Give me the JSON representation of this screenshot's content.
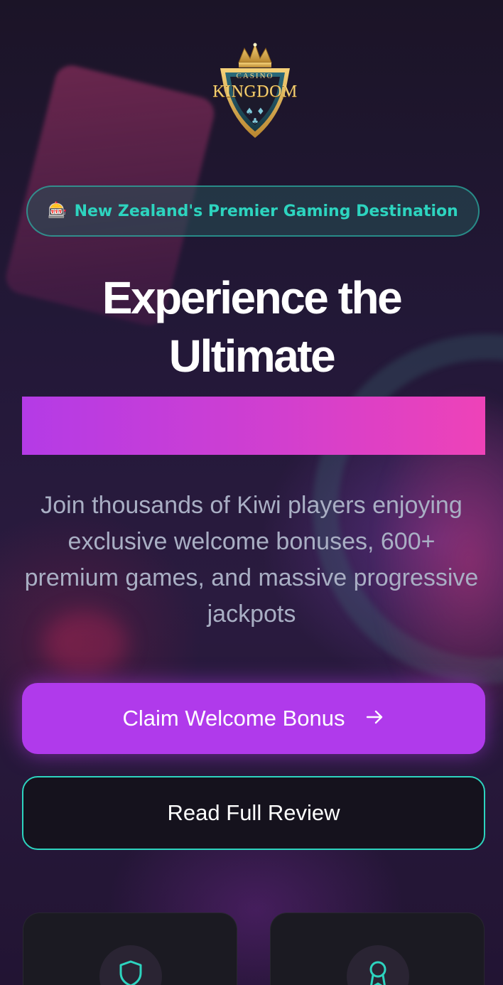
{
  "brand": {
    "logo_top": "CASINO",
    "logo_bottom": "KINGDOM"
  },
  "badge": {
    "icon": "slot-machine-icon",
    "text": "New Zealand's Premier Gaming Destination"
  },
  "hero": {
    "headline": "Experience the Ultimate",
    "subtext": "Join thousands of Kiwi players enjoying exclusive welcome bonuses, 600+ premium games, and massive progressive jackpots"
  },
  "actions": {
    "primary_label": "Claim Welcome Bonus",
    "secondary_label": "Read Full Review"
  },
  "features": [
    {
      "icon": "shield-icon"
    },
    {
      "icon": "award-ribbon-icon"
    }
  ],
  "colors": {
    "accent_teal": "#2dd4bf",
    "accent_purple": "#b03aeb",
    "accent_pink": "#ee42b8",
    "background": "#1b1427"
  }
}
